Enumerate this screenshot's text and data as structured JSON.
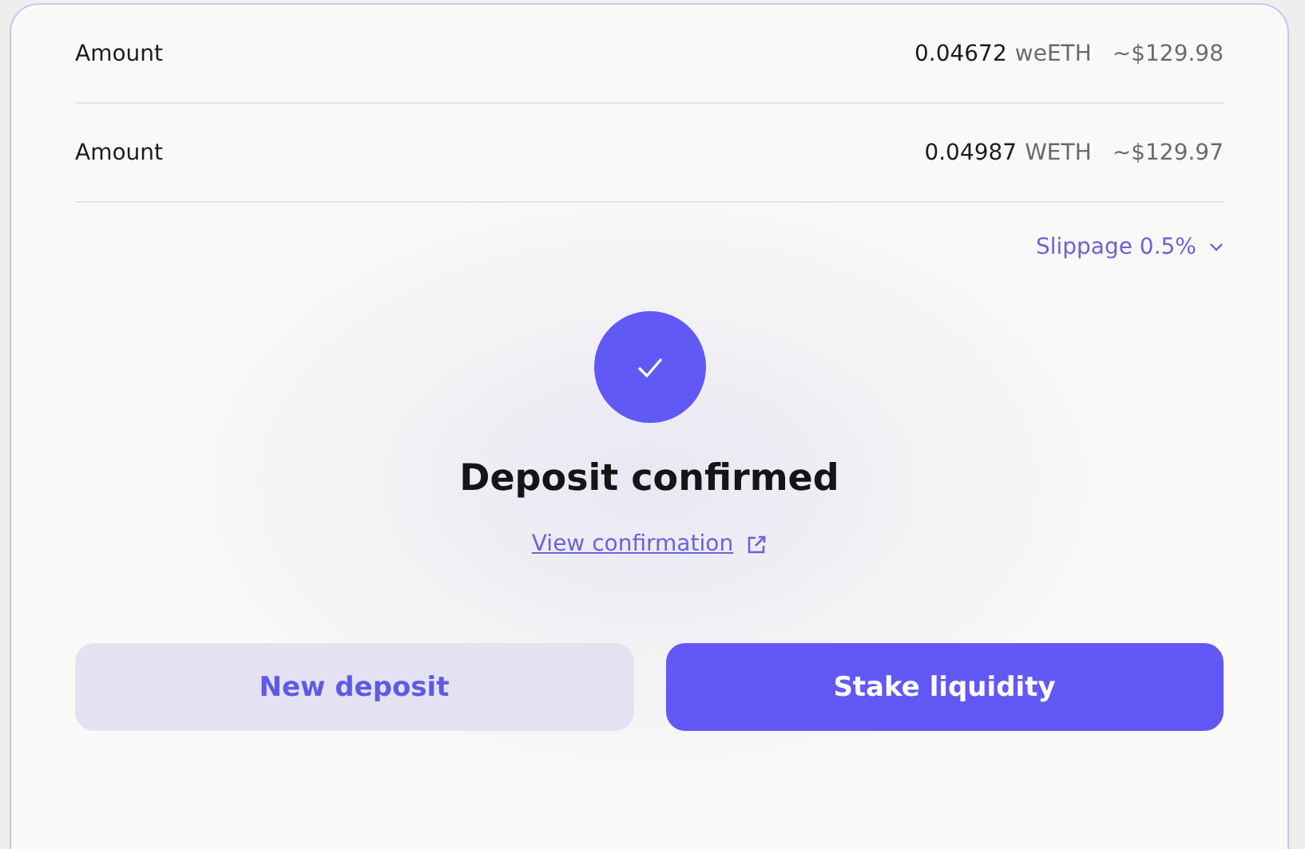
{
  "amounts": [
    {
      "label": "Amount",
      "value": "0.04672",
      "token": "weETH",
      "usd": "~$129.98"
    },
    {
      "label": "Amount",
      "value": "0.04987",
      "token": "WETH",
      "usd": "~$129.97"
    }
  ],
  "slippage": {
    "label": "Slippage 0.5%",
    "expanded": false
  },
  "status": {
    "title": "Deposit confirmed",
    "link": "View confirmation"
  },
  "buttons": [
    {
      "label": "New deposit",
      "kind": "secondary"
    },
    {
      "label": "Stake liquidity",
      "kind": "primary"
    }
  ]
}
